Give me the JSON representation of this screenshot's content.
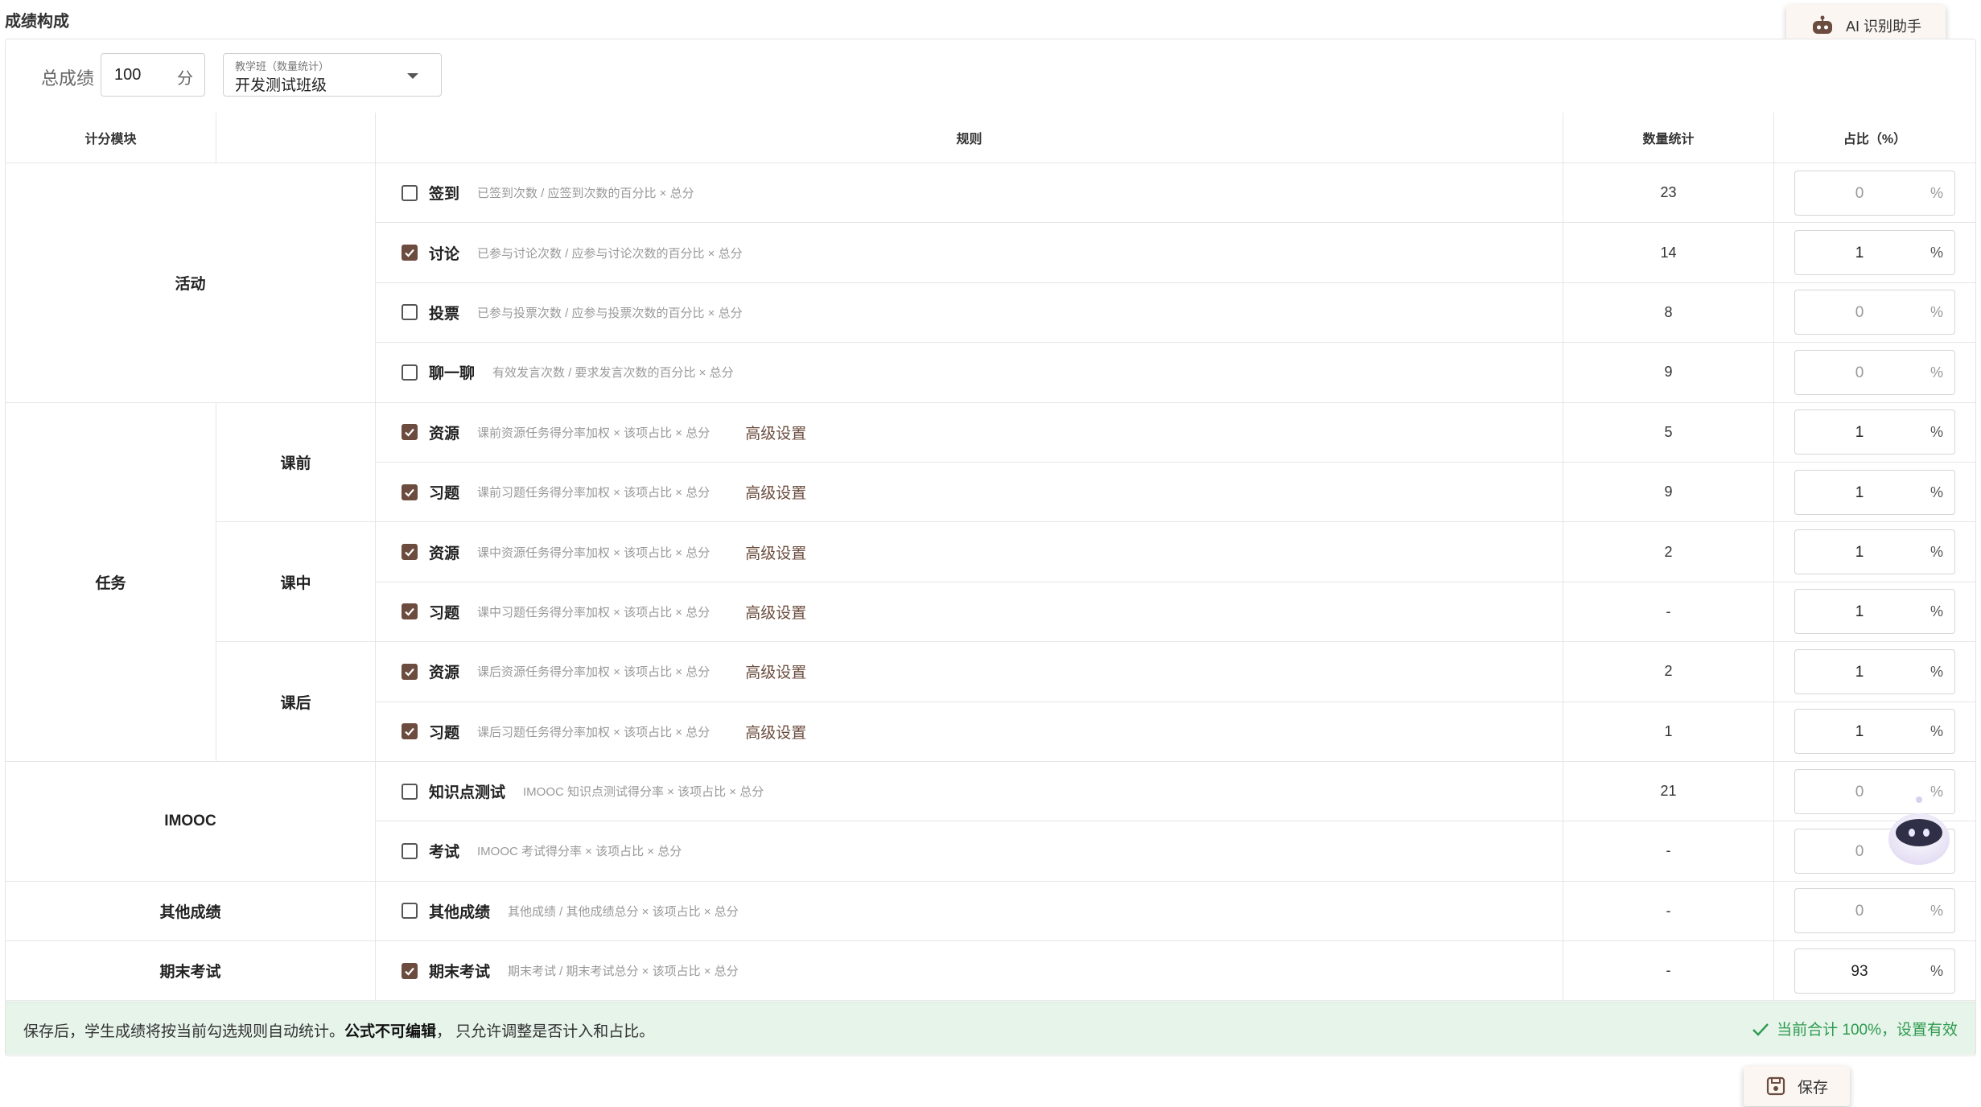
{
  "page": {
    "title": "成绩构成"
  },
  "ai_button": {
    "label": "AI 识别助手",
    "icon": "robot-icon"
  },
  "controls": {
    "total_label": "总成绩",
    "total_value": "100",
    "total_unit": "分",
    "class_select": {
      "caption": "教学班（数量统计）",
      "value": "开发测试班级"
    }
  },
  "table": {
    "headers": {
      "module": "计分模块",
      "rule": "规则",
      "count": "数量统计",
      "ratio": "占比（%）"
    },
    "groups": {
      "activity": "活动",
      "task": "任务",
      "task_pre": "课前",
      "task_in": "课中",
      "task_post": "课后",
      "imooc": "IMOOC",
      "other": "其他成绩",
      "final": "期末考试"
    },
    "advanced_label": "高级设置",
    "percent_unit": "%",
    "rows": [
      {
        "name": "签到",
        "formula": "已签到次数 / 应签到次数的百分比 × 总分",
        "count": "23",
        "ratio": "0",
        "checked": false,
        "advanced": false
      },
      {
        "name": "讨论",
        "formula": "已参与讨论次数 / 应参与讨论次数的百分比 × 总分",
        "count": "14",
        "ratio": "1",
        "checked": true,
        "advanced": false
      },
      {
        "name": "投票",
        "formula": "已参与投票次数 / 应参与投票次数的百分比 × 总分",
        "count": "8",
        "ratio": "0",
        "checked": false,
        "advanced": false
      },
      {
        "name": "聊一聊",
        "formula": "有效发言次数 / 要求发言次数的百分比 × 总分",
        "count": "9",
        "ratio": "0",
        "checked": false,
        "advanced": false
      },
      {
        "name": "资源",
        "formula": "课前资源任务得分率加权 × 该项占比 × 总分",
        "count": "5",
        "ratio": "1",
        "checked": true,
        "advanced": true
      },
      {
        "name": "习题",
        "formula": "课前习题任务得分率加权 × 该项占比 × 总分",
        "count": "9",
        "ratio": "1",
        "checked": true,
        "advanced": true
      },
      {
        "name": "资源",
        "formula": "课中资源任务得分率加权 × 该项占比 × 总分",
        "count": "2",
        "ratio": "1",
        "checked": true,
        "advanced": true
      },
      {
        "name": "习题",
        "formula": "课中习题任务得分率加权 × 该项占比 × 总分",
        "count": "-",
        "ratio": "1",
        "checked": true,
        "advanced": true
      },
      {
        "name": "资源",
        "formula": "课后资源任务得分率加权 × 该项占比 × 总分",
        "count": "2",
        "ratio": "1",
        "checked": true,
        "advanced": true
      },
      {
        "name": "习题",
        "formula": "课后习题任务得分率加权 × 该项占比 × 总分",
        "count": "1",
        "ratio": "1",
        "checked": true,
        "advanced": true
      },
      {
        "name": "知识点测试",
        "formula": "IMOOC 知识点测试得分率 × 该项占比 × 总分",
        "count": "21",
        "ratio": "0",
        "checked": false,
        "advanced": false
      },
      {
        "name": "考试",
        "formula": "IMOOC 考试得分率 × 该项占比 × 总分",
        "count": "-",
        "ratio": "0",
        "checked": false,
        "advanced": false
      },
      {
        "name": "其他成绩",
        "formula": "其他成绩 / 其他成绩总分 × 该项占比 × 总分",
        "count": "-",
        "ratio": "0",
        "checked": false,
        "advanced": false
      },
      {
        "name": "期末考试",
        "formula": "期末考试 / 期末考试总分 × 该项占比 × 总分",
        "count": "-",
        "ratio": "93",
        "checked": true,
        "advanced": false
      }
    ]
  },
  "notice": {
    "text_before": "保存后，学生成绩将按当前勾选规则自动统计。",
    "text_bold": "公式不可编辑",
    "text_after": "， 只允许调整是否计入和占比。",
    "status": "当前合计 100%，设置有效",
    "status_color": "#2e9b4f"
  },
  "save_button": {
    "label": "保存",
    "icon": "save-icon"
  },
  "colors": {
    "accent": "#6b4c3e",
    "notice_bg": "#e7f4ea"
  }
}
